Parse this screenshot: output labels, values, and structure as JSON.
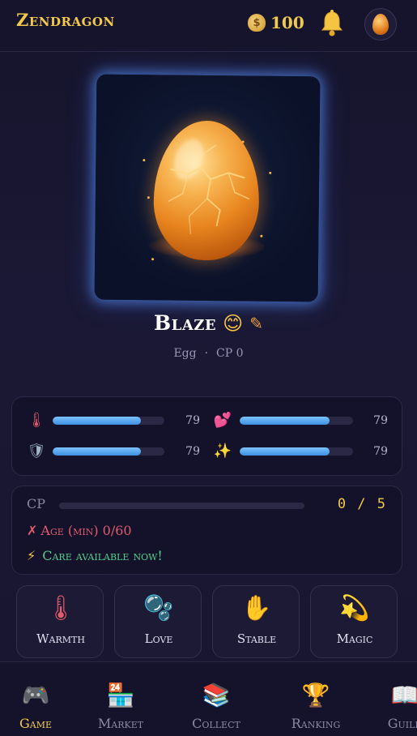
{
  "header": {
    "title": "Zendragon",
    "coins": "100",
    "coin_icon": "money-bag-icon",
    "bell_icon": "bell-icon",
    "avatar_icon": "egg-avatar-icon"
  },
  "pet": {
    "name": "Blaze",
    "emoji": "😊",
    "edit_icon": "✎",
    "stage": "Egg",
    "separator": "·",
    "cp_text": "CP 0",
    "image": "glowing-cracked-orange-egg"
  },
  "stats": [
    {
      "icon": "thermometer-icon",
      "glyph": "🌡",
      "value": "79",
      "level": 0.79,
      "color": "#e05b6b"
    },
    {
      "icon": "hearts-icon",
      "glyph": "💕",
      "value": "79",
      "level": 0.79,
      "color": "#e86aa8"
    },
    {
      "icon": "shield-icon",
      "glyph": "🛡",
      "value": "79",
      "level": 0.79,
      "color": "#9fb4c8"
    },
    {
      "icon": "sparkles-icon",
      "glyph": "✨",
      "value": "79",
      "level": 0.79,
      "color": "#f2c94c"
    }
  ],
  "cp": {
    "label": "CP",
    "value": "0 / 5",
    "progress": 0
  },
  "age": {
    "icon": "✗",
    "text": "Age (min) 0/60"
  },
  "care": {
    "icon": "⚡",
    "text": "Care available now!"
  },
  "actions": [
    {
      "label": "Warmth",
      "icon": "thermometer-icon",
      "glyph": "🌡",
      "color": "#e05b6b"
    },
    {
      "label": "Love",
      "icon": "bubbles-icon",
      "glyph": "🫧",
      "color": "#7fc4ee"
    },
    {
      "label": "Stable",
      "icon": "raised-hand-icon",
      "glyph": "✋",
      "color": "#f5c04a"
    },
    {
      "label": "Magic",
      "icon": "shooting-star-icon",
      "glyph": "💫",
      "color": "#f2c94c"
    }
  ],
  "nav": [
    {
      "label": "Game",
      "icon": "gamepad-icon",
      "glyph": "🎮",
      "active": true
    },
    {
      "label": "Market",
      "icon": "store-icon",
      "glyph": "🏪",
      "active": false
    },
    {
      "label": "Collect",
      "icon": "books-icon",
      "glyph": "📚",
      "active": false
    },
    {
      "label": "Ranking",
      "icon": "trophy-icon",
      "glyph": "🏆",
      "active": false
    },
    {
      "label": "Guild",
      "icon": "book-icon",
      "glyph": "📖",
      "active": false
    }
  ]
}
